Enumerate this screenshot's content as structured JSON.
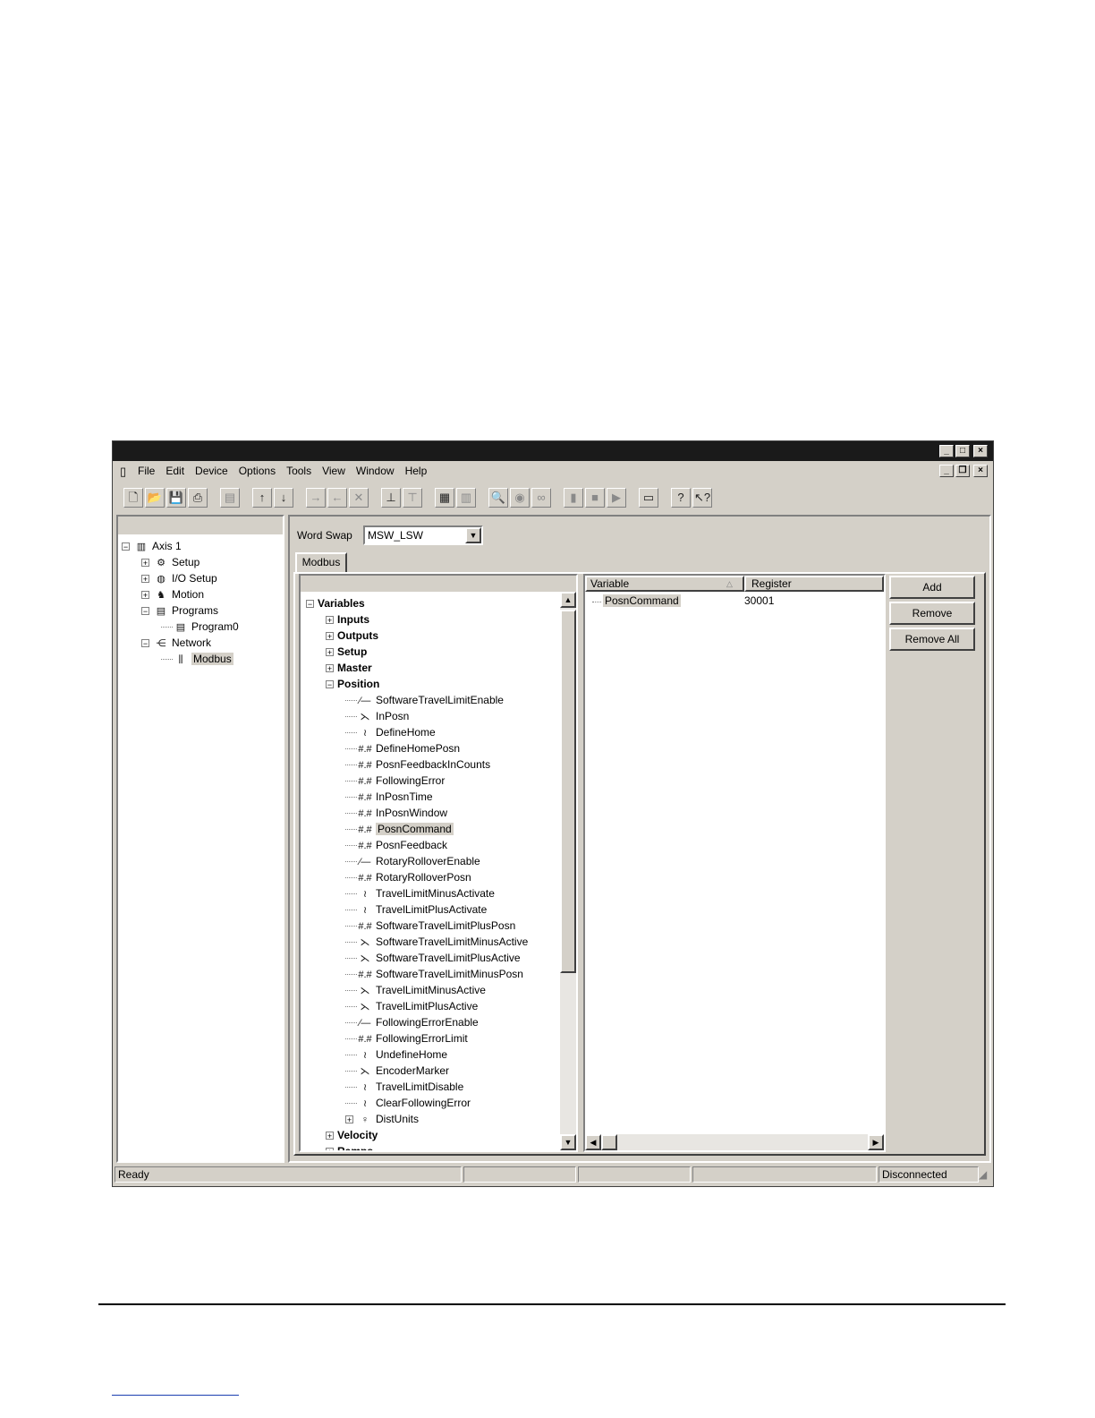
{
  "menu": [
    "File",
    "Edit",
    "Device",
    "Options",
    "Tools",
    "View",
    "Window",
    "Help"
  ],
  "left_tree": [
    {
      "label": "Axis 1",
      "level": 0,
      "expander": "minus",
      "icon": "drive-icon"
    },
    {
      "label": "Setup",
      "level": 1,
      "expander": "plus",
      "icon": "setup-icon"
    },
    {
      "label": "I/O Setup",
      "level": 1,
      "expander": "plus",
      "icon": "io-icon"
    },
    {
      "label": "Motion",
      "level": 1,
      "expander": "plus",
      "icon": "motion-icon"
    },
    {
      "label": "Programs",
      "level": 1,
      "expander": "minus",
      "icon": "program-icon"
    },
    {
      "label": "Program0",
      "level": 2,
      "expander": "",
      "icon": "program-icon"
    },
    {
      "label": "Network",
      "level": 1,
      "expander": "minus",
      "icon": "network-icon"
    },
    {
      "label": "Modbus",
      "level": 2,
      "expander": "",
      "icon": "modbus-icon",
      "selected": true
    }
  ],
  "word_swap": {
    "label": "Word Swap",
    "value": "MSW_LSW"
  },
  "tab": {
    "label": "Modbus"
  },
  "var_tree": [
    {
      "label": "Variables",
      "level": 0,
      "expander": "minus",
      "bold": true
    },
    {
      "label": "Inputs",
      "level": 1,
      "expander": "plus",
      "bold": true
    },
    {
      "label": "Outputs",
      "level": 1,
      "expander": "plus",
      "bold": true
    },
    {
      "label": "Setup",
      "level": 1,
      "expander": "plus",
      "bold": true
    },
    {
      "label": "Master",
      "level": 1,
      "expander": "plus",
      "bold": true
    },
    {
      "label": "Position",
      "level": 1,
      "expander": "minus",
      "bold": true
    },
    {
      "label": "SoftwareTravelLimitEnable",
      "level": 2,
      "icon": "bool-icon"
    },
    {
      "label": "InPosn",
      "level": 2,
      "icon": "status-icon"
    },
    {
      "label": "DefineHome",
      "level": 2,
      "icon": "event-icon"
    },
    {
      "label": "DefineHomePosn",
      "level": 2,
      "icon": "numeric-icon"
    },
    {
      "label": "PosnFeedbackInCounts",
      "level": 2,
      "icon": "numeric-readonly-icon"
    },
    {
      "label": "FollowingError",
      "level": 2,
      "icon": "numeric-readonly-icon"
    },
    {
      "label": "InPosnTime",
      "level": 2,
      "icon": "numeric-icon"
    },
    {
      "label": "InPosnWindow",
      "level": 2,
      "icon": "numeric-icon"
    },
    {
      "label": "PosnCommand",
      "level": 2,
      "icon": "numeric-readonly-icon",
      "selected": true
    },
    {
      "label": "PosnFeedback",
      "level": 2,
      "icon": "numeric-readonly-icon"
    },
    {
      "label": "RotaryRolloverEnable",
      "level": 2,
      "icon": "bool-icon"
    },
    {
      "label": "RotaryRolloverPosn",
      "level": 2,
      "icon": "numeric-icon"
    },
    {
      "label": "TravelLimitMinusActivate",
      "level": 2,
      "icon": "event-icon"
    },
    {
      "label": "TravelLimitPlusActivate",
      "level": 2,
      "icon": "event-icon"
    },
    {
      "label": "SoftwareTravelLimitPlusPosn",
      "level": 2,
      "icon": "numeric-icon"
    },
    {
      "label": "SoftwareTravelLimitMinusActive",
      "level": 2,
      "icon": "status-icon"
    },
    {
      "label": "SoftwareTravelLimitPlusActive",
      "level": 2,
      "icon": "status-icon"
    },
    {
      "label": "SoftwareTravelLimitMinusPosn",
      "level": 2,
      "icon": "numeric-icon"
    },
    {
      "label": "TravelLimitMinusActive",
      "level": 2,
      "icon": "status-icon"
    },
    {
      "label": "TravelLimitPlusActive",
      "level": 2,
      "icon": "status-icon"
    },
    {
      "label": "FollowingErrorEnable",
      "level": 2,
      "icon": "bool-icon"
    },
    {
      "label": "FollowingErrorLimit",
      "level": 2,
      "icon": "numeric-icon"
    },
    {
      "label": "UndefineHome",
      "level": 2,
      "icon": "event-icon"
    },
    {
      "label": "EncoderMarker",
      "level": 2,
      "icon": "status-icon"
    },
    {
      "label": "TravelLimitDisable",
      "level": 2,
      "icon": "event-icon"
    },
    {
      "label": "ClearFollowingError",
      "level": 2,
      "icon": "event-icon"
    },
    {
      "label": "DistUnits",
      "level": 2,
      "expander": "plus",
      "icon": "units-icon"
    },
    {
      "label": "Velocity",
      "level": 1,
      "expander": "plus",
      "bold": true
    },
    {
      "label": "Ramps",
      "level": 1,
      "expander": "plus",
      "bold": true
    }
  ],
  "list": {
    "columns": [
      "Variable",
      "Register"
    ],
    "rows": [
      {
        "variable": "PosnCommand",
        "register": "30001"
      }
    ]
  },
  "buttons": {
    "add": "Add",
    "remove": "Remove",
    "remove_all": "Remove All"
  },
  "status": {
    "left": "Ready",
    "right": "Disconnected"
  }
}
